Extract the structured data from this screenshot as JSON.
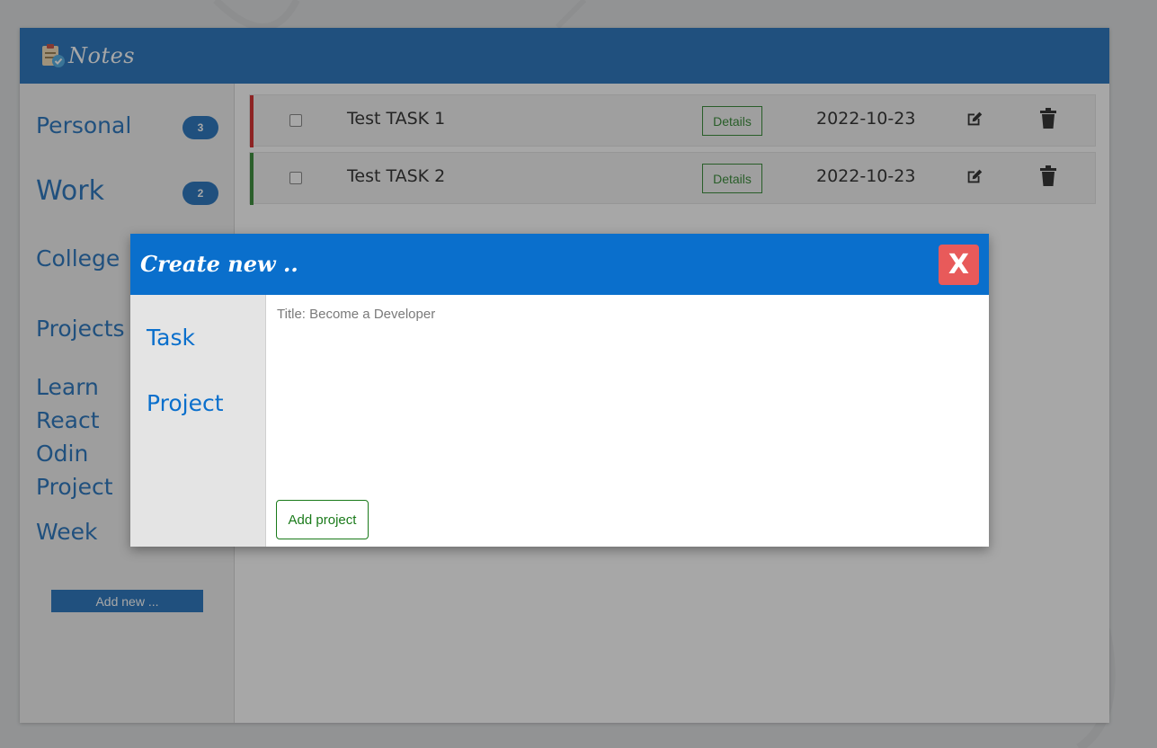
{
  "app": {
    "title": "Notes"
  },
  "sidebar": {
    "items": [
      {
        "label": "Personal",
        "count": "3"
      },
      {
        "label": "Work",
        "count": "2"
      },
      {
        "label": "College"
      },
      {
        "label": "Projects"
      },
      {
        "label_lines": [
          "Learn",
          "React",
          "Odin",
          "Project"
        ]
      },
      {
        "label": "Week"
      }
    ],
    "add_new_label": "Add new ..."
  },
  "tasks": [
    {
      "title": "Test TASK 1",
      "details_label": "Details",
      "date": "2022-10-23",
      "priority_color": "#d01010"
    },
    {
      "title": "Test TASK 2",
      "details_label": "Details",
      "date": "2022-10-23",
      "priority_color": "#1e7d1e"
    }
  ],
  "modal": {
    "title": "Create new ..",
    "close_label": "X",
    "nav": [
      {
        "label": "Task"
      },
      {
        "label": "Project"
      }
    ],
    "title_placeholder": "Title: Become a Developer",
    "submit_label": "Add project"
  },
  "colors": {
    "brand": "#0a62b4",
    "modal_header": "#0a6fcc",
    "close": "#e85a5a",
    "success": "#1a7a1a"
  },
  "icons": {
    "logo": "notes-clipboard-icon",
    "edit": "edit-icon",
    "delete": "trash-icon"
  }
}
